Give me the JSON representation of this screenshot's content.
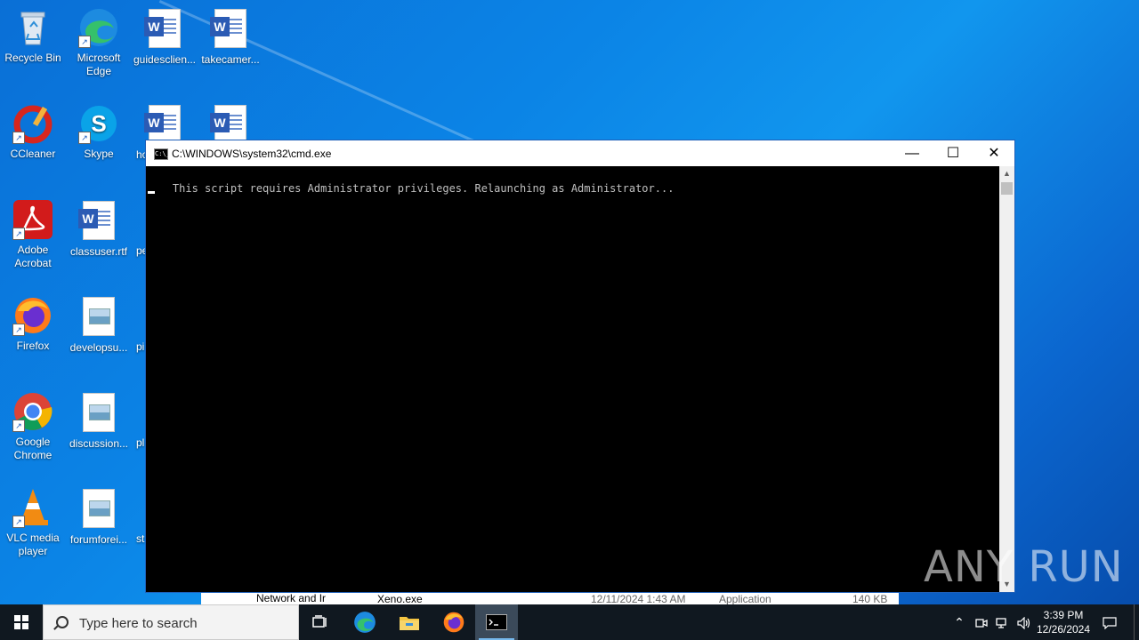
{
  "desktop": {
    "icons": [
      {
        "label": "Recycle Bin"
      },
      {
        "label": "Microsoft Edge"
      },
      {
        "label": "guidesclien..."
      },
      {
        "label": "takecamer..."
      },
      {
        "label": "CCleaner"
      },
      {
        "label": "Skype"
      },
      {
        "label": "Adobe Acrobat"
      },
      {
        "label": "classuser.rtf"
      },
      {
        "label": "Firefox"
      },
      {
        "label": "developsu..."
      },
      {
        "label": "Google Chrome"
      },
      {
        "label": "discussion..."
      },
      {
        "label": "VLC media player"
      },
      {
        "label": "forumforei..."
      }
    ],
    "partial_labels": [
      "ho",
      "pe",
      "pi",
      "pl",
      "st"
    ]
  },
  "cmd_window": {
    "title": "C:\\WINDOWS\\system32\\cmd.exe",
    "icon_text": "C:\\_",
    "minimize": "—",
    "maximize": "☐",
    "close": "✕",
    "output": "This script requires Administrator privileges. Relaunching as Administrator..."
  },
  "background_explorer": {
    "nav_item": "Network and Ir",
    "row": {
      "name": "Xeno.exe",
      "date": "12/11/2024 1:43 AM",
      "type": "Application",
      "size": "140 KB"
    }
  },
  "watermark": "ANY RUN",
  "taskbar": {
    "search_placeholder": "Type here to search",
    "clock_time": "3:39 PM",
    "clock_date": "12/26/2024"
  },
  "colors": {
    "desktop_blue": "#0b84e6",
    "taskbar": "#101820",
    "console_bg": "#000000",
    "console_text": "#c0c0c0"
  }
}
